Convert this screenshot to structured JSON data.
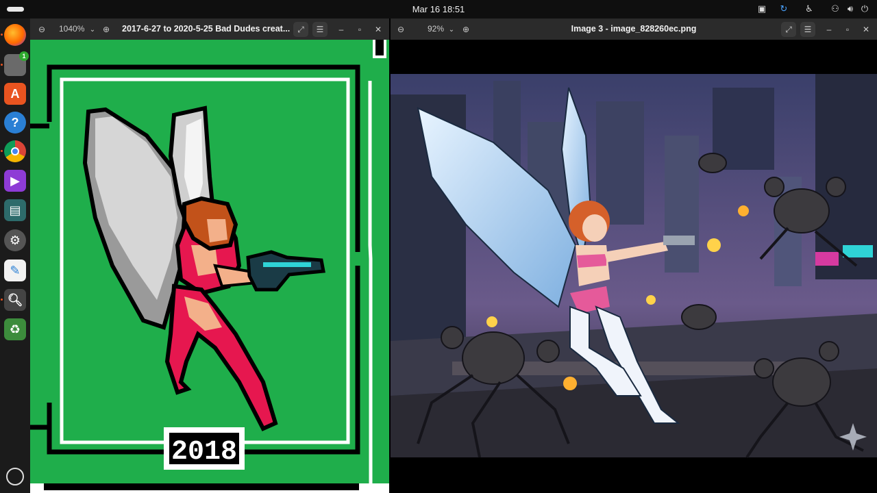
{
  "topbar": {
    "clock": "Mar 16  18:51",
    "tray_icons": [
      "display-icon",
      "sync-icon",
      "accessibility-icon",
      "network-icon",
      "volume-icon",
      "power-icon"
    ]
  },
  "dock": {
    "items": [
      "firefox",
      "files",
      "app-center",
      "help",
      "chrome",
      "media-player",
      "screenshot-tool",
      "settings",
      "text-editor",
      "image-viewer",
      "trash"
    ],
    "files_badge": "1"
  },
  "left_window": {
    "zoom": "1040%",
    "title": "2017-6-27 to 2020-5-25 Bad Dudes creat...",
    "badge_text": "2018",
    "colors": {
      "green": "#1fae4b",
      "black": "#000000",
      "white": "#ffffff"
    }
  },
  "right_window": {
    "zoom": "92%",
    "title": "Image 3 - image_828260ec.png"
  }
}
